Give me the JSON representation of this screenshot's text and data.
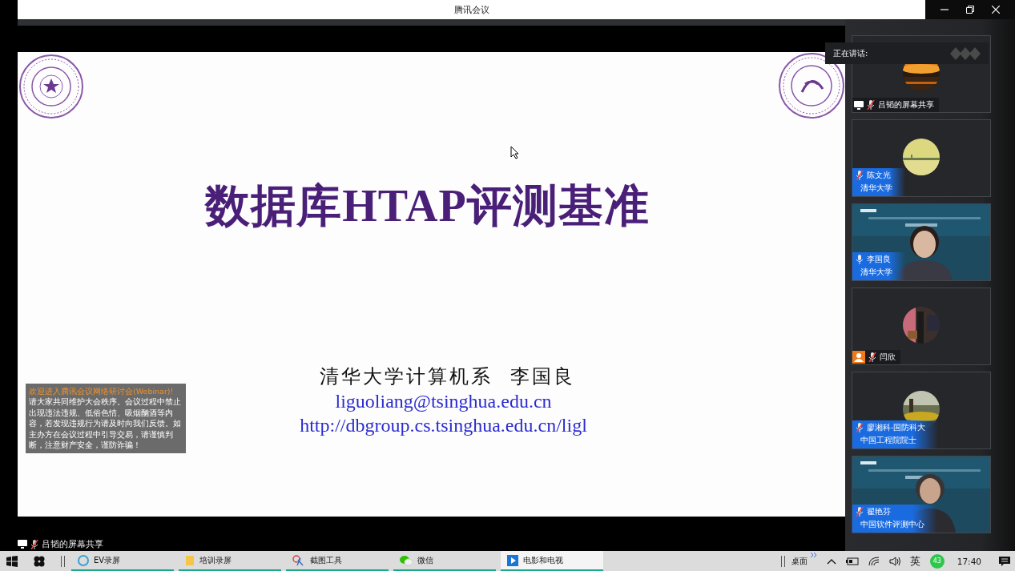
{
  "window": {
    "title": "腾讯会议"
  },
  "slide": {
    "title": "数据库HTAP评测基准",
    "author": "清华大学计算机系  李国良",
    "email": "liguoliang@tsinghua.edu.cn",
    "url": "http://dbgroup.cs.tsinghua.edu.cn/ligl"
  },
  "notice": {
    "heading": "欢迎进入腾讯会议网络研讨会(Webinar)!",
    "body": "请大家共同维护大会秩序。会议过程中禁止出现违法违规、低俗色情、吸烟酗酒等内容，若发现违规行为请及时向我们反馈。如主办方在会议过程中引导交易，请谨慎判断，注意财产安全，谨防诈骗！"
  },
  "speaking": {
    "label": "正在讲话:"
  },
  "participants": [
    {
      "kind": "share",
      "name": "吕韬的屏幕共享",
      "muted": true
    },
    {
      "kind": "avatar",
      "name": "陈文光",
      "org": "清华大学",
      "muted": true
    },
    {
      "kind": "video",
      "name": "李国良",
      "org": "清华大学",
      "muted": false
    },
    {
      "kind": "guest",
      "name": "闫欣",
      "muted": true
    },
    {
      "kind": "avatar",
      "name": "廖湘科-国防科大",
      "org": "中国工程院院士",
      "muted": true
    },
    {
      "kind": "video",
      "name": "翟艳芬",
      "org": "中国软件评测中心",
      "muted": true
    }
  ],
  "share_label": {
    "text": "吕韬的屏幕共享",
    "muted": true
  },
  "taskbar": {
    "apps": [
      {
        "label": "EV录屏",
        "selected": false
      },
      {
        "label": "培训录屏",
        "selected": false
      },
      {
        "label": "截图工具",
        "selected": false
      },
      {
        "label": "微信",
        "selected": false
      },
      {
        "label": "电影和电视",
        "selected": true
      }
    ],
    "desktop": "桌面",
    "ime": "英",
    "badge": "43",
    "time": "17:40"
  }
}
